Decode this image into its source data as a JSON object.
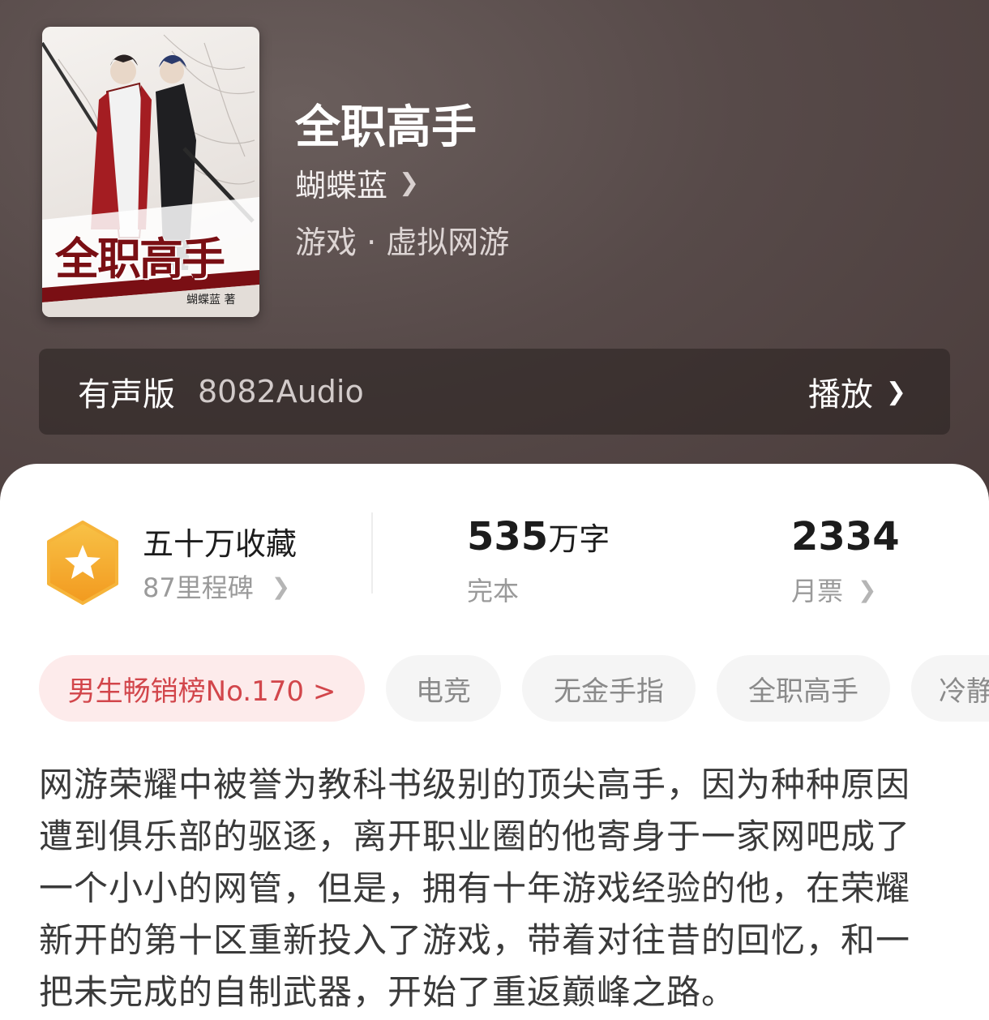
{
  "book": {
    "title": "全职高手",
    "author": "蝴蝶蓝",
    "genre": "游戏 · 虚拟网游",
    "cover": {
      "title_text": "全职高手",
      "author_text": "蝴蝶蓝  著"
    }
  },
  "audio": {
    "label": "有声版",
    "source": "8082Audio",
    "play_label": "播放"
  },
  "stats": {
    "collections": {
      "main": "五十万收藏",
      "sub": "87里程碑",
      "badge_icon": "star-hexagon-icon",
      "badge_color": "#F5A623"
    },
    "words": {
      "number": "535",
      "unit": "万字",
      "sub": "完本"
    },
    "tickets": {
      "number": "2334",
      "sub": "月票"
    }
  },
  "tags": [
    {
      "label": "男生畅销榜No.170 >",
      "highlight": true
    },
    {
      "label": "电竞"
    },
    {
      "label": "无金手指"
    },
    {
      "label": "全职高手"
    },
    {
      "label": "冷静"
    }
  ],
  "colors": {
    "hero_bg": "#574A49",
    "rank_tag_bg": "#FDEBEB",
    "rank_tag_text": "#D2464B"
  },
  "description": "网游荣耀中被誉为教科书级别的顶尖高手，因为种种原因遭到俱乐部的驱逐，离开职业圈的他寄身于一家网吧成了一个小小的网管，但是，拥有十年游戏经验的他，在荣耀新开的第十区重新投入了游戏，带着对往昔的回忆，和一把未完成的自制武器，开始了重返巅峰之路。"
}
